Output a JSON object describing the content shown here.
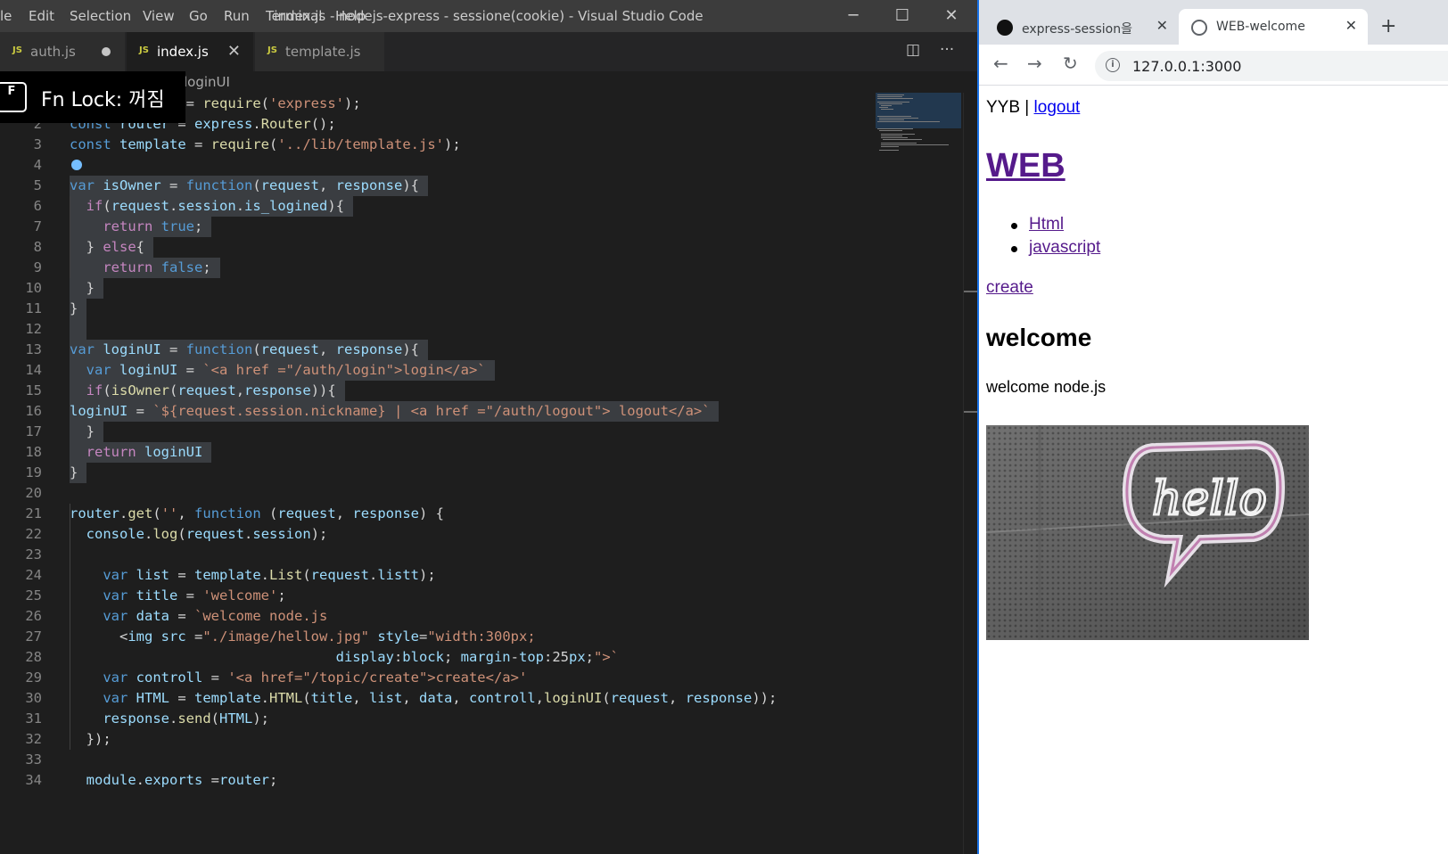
{
  "vscode": {
    "menu": [
      "le",
      "Edit",
      "Selection",
      "View",
      "Go",
      "Run",
      "Terminal",
      "Help"
    ],
    "title": "index.js - nodejs-express - sessione(cookie) - Visual Studio Code",
    "window_buttons": {
      "minimize": "─",
      "maximize": "☐",
      "close": "✕"
    },
    "tabs": [
      {
        "icon": "JS",
        "label": "auth.js",
        "state": "modified"
      },
      {
        "icon": "JS",
        "label": "index.js",
        "state": "active",
        "close": "✕"
      },
      {
        "icon": "JS",
        "label": "template.js",
        "state": "normal"
      }
    ],
    "tab_actions": {
      "split": "◫",
      "more": "···"
    },
    "breadcrumb": "loginUI",
    "fn_lock": {
      "key": "F",
      "text": "Fn Lock: 꺼짐"
    },
    "code_lines": [
      "const express = require('express');",
      "const router = express.Router();",
      "const template = require('../lib/template.js');",
      "",
      "var isOwner = function(request, response){",
      "  if(request.session.is_logined){",
      "    return true;",
      "  } else{",
      "    return false;",
      "  }",
      "}",
      "",
      "var loginUI = function(request, response){",
      "  var loginUI = `<a href =\"/auth/login\">login</a>`",
      "  if(isOwner(request,response)){",
      "loginUI = `${request.session.nickname} | <a href =\"/auth/logout\"> logout</a>`",
      "  }",
      "  return loginUI",
      "}",
      "",
      "router.get('', function (request, response) {",
      "  console.log(request.session);",
      "",
      "    var list = template.List(request.listt);",
      "    var title = 'welcome';",
      "    var data = `welcome node.js",
      "      <img src =\"./image/hellow.jpg\" style=\"width:300px;",
      "                                display:block; margin-top:25px;\">`",
      "    var controll = '<a href=\"/topic/create\">create</a>'",
      "    var HTML = template.HTML(title, list, data, controll,loginUI(request, response));",
      "    response.send(HTML);",
      "  });",
      "",
      "  module.exports =router;"
    ]
  },
  "chrome": {
    "tabs": [
      {
        "title": "express-session을 이",
        "close": "✕"
      },
      {
        "title": "WEB-welcome",
        "close": "✕"
      }
    ],
    "new_tab": "+",
    "nav": {
      "back": "←",
      "forward": "→",
      "reload": "↻"
    },
    "url": "127.0.0.1:3000",
    "info_icon": "i",
    "star": "☆",
    "page": {
      "nickname": "YYB",
      "separator": " | ",
      "logout": "logout",
      "h1": "WEB",
      "list": [
        "Html",
        "javascript"
      ],
      "create": "create",
      "h2": "welcome",
      "data_text": "welcome node.js",
      "image_text": "hello"
    }
  },
  "colors": {
    "keyword": "#569cd6",
    "function": "#dcdcaa",
    "string": "#ce9178",
    "variable": "#9cdcfe",
    "control": "#c586c0",
    "selection": "#3a3d41",
    "chrome_accent": "#1a73e8"
  }
}
